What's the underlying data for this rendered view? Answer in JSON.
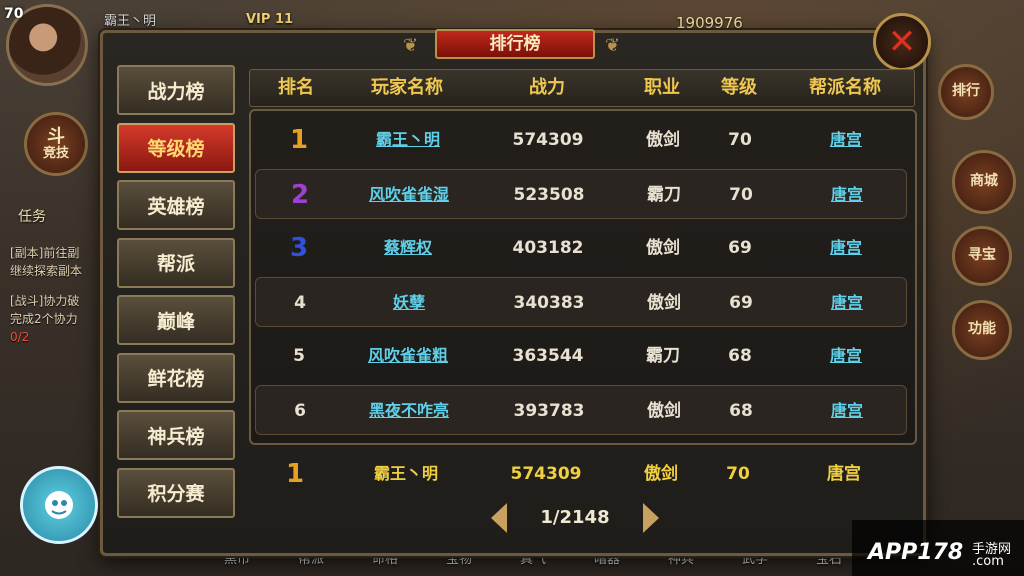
{
  "background": {
    "level": "70",
    "player": "霸王丶明",
    "vip": "VIP 11",
    "gold": "1909976",
    "arena": "竞技",
    "arena_icon": "斗",
    "task_label": "任务",
    "task_lines": [
      "[副本]前往副",
      "继续探索副本",
      "[战斗]协力破",
      "完成2个协力",
      "0/2"
    ],
    "right_btns": [
      "排行",
      "商城",
      "寻宝",
      "功能"
    ],
    "bottom_bar": [
      "黑市",
      "帮派",
      "命格",
      "宝物",
      "真气",
      "暗器",
      "神兵",
      "武学",
      "宝石"
    ]
  },
  "panel": {
    "title": "排行榜",
    "close_icon": "✕",
    "tabs": [
      "战力榜",
      "等级榜",
      "英雄榜",
      "帮派",
      "巅峰",
      "鲜花榜",
      "神兵榜",
      "积分赛"
    ],
    "active_tab": 1,
    "headers": [
      "排名",
      "玩家名称",
      "战力",
      "职业",
      "等级",
      "帮派名称"
    ],
    "rank_colors": {
      "1": "#e8a020",
      "2": "#a040d0",
      "3": "#3050e0"
    },
    "rows": [
      {
        "rank": "1",
        "name": "霸王丶明",
        "power": "574309",
        "job": "傲剑",
        "level": "70",
        "guild": "唐宫"
      },
      {
        "rank": "2",
        "name": "风吹雀雀湿",
        "power": "523508",
        "job": "霸刀",
        "level": "70",
        "guild": "唐宫"
      },
      {
        "rank": "3",
        "name": "蔡辉权",
        "power": "403182",
        "job": "傲剑",
        "level": "69",
        "guild": "唐宫"
      },
      {
        "rank": "4",
        "name": "妖孽",
        "power": "340383",
        "job": "傲剑",
        "level": "69",
        "guild": "唐宫"
      },
      {
        "rank": "5",
        "name": "风吹雀雀粗",
        "power": "363544",
        "job": "霸刀",
        "level": "68",
        "guild": "唐宫"
      },
      {
        "rank": "6",
        "name": "黑夜不咋亮",
        "power": "393783",
        "job": "傲剑",
        "level": "68",
        "guild": "唐宫"
      }
    ],
    "self": {
      "rank": "1",
      "name": "霸王丶明",
      "power": "574309",
      "job": "傲剑",
      "level": "70",
      "guild": "唐宫"
    },
    "pagination": "1/2148"
  },
  "watermark": {
    "brand": "APP178",
    "sub1": "手游网",
    "sub2": ".com"
  }
}
